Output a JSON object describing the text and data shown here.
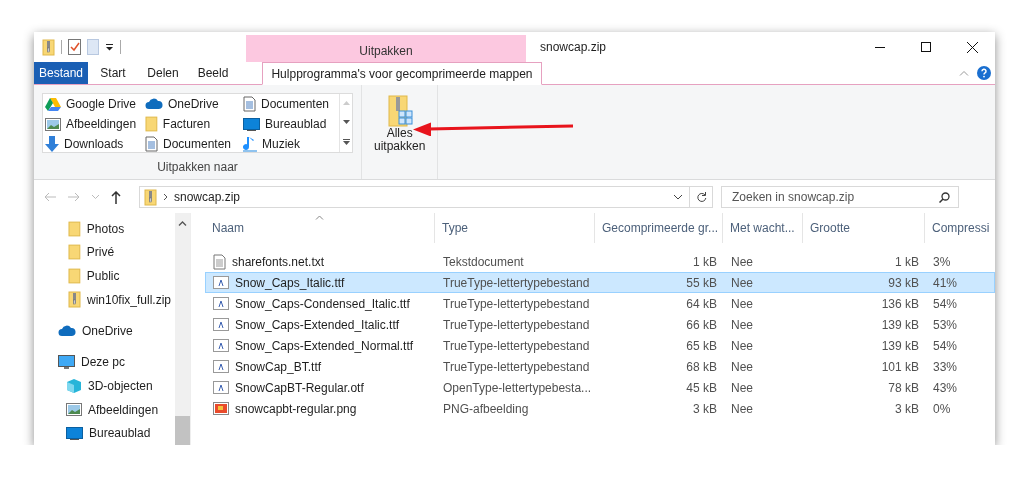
{
  "window": {
    "title": "snowcap.zip"
  },
  "ribbon": {
    "context_header": "Uitpakken",
    "tabs": [
      {
        "label": "Bestand",
        "kind": "file",
        "selected": false
      },
      {
        "label": "Start",
        "kind": "plain",
        "selected": false
      },
      {
        "label": "Delen",
        "kind": "plain",
        "selected": false
      },
      {
        "label": "Beeld",
        "kind": "plain",
        "selected": false
      },
      {
        "label": "Hulpprogramma's voor gecomprimeerde mappen",
        "kind": "context",
        "selected": true
      }
    ],
    "destinations": [
      {
        "label": "Google Drive",
        "kind": "gdrive"
      },
      {
        "label": "OneDrive",
        "kind": "cloud"
      },
      {
        "label": "Documenten",
        "kind": "doc"
      },
      {
        "label": "Afbeeldingen",
        "kind": "pictures"
      },
      {
        "label": "Facturen",
        "kind": "folder"
      },
      {
        "label": "Bureaublad",
        "kind": "desktop"
      },
      {
        "label": "Downloads",
        "kind": "download"
      },
      {
        "label": "Documenten",
        "kind": "doc"
      },
      {
        "label": "Muziek",
        "kind": "music"
      }
    ],
    "group_label": "Uitpakken naar",
    "extract_button": "Alles\nuitpakken"
  },
  "address": {
    "path": "snowcap.zip",
    "search_placeholder": "Zoeken in snowcap.zip"
  },
  "sidebar": {
    "items": [
      {
        "label": "Photos",
        "kind": "folder"
      },
      {
        "label": "Privé",
        "kind": "folder"
      },
      {
        "label": "Public",
        "kind": "folder"
      },
      {
        "label": "win10fix_full.zip",
        "kind": "zip"
      },
      {
        "label": "OneDrive",
        "kind": "cloud"
      },
      {
        "label": "Deze pc",
        "kind": "pc",
        "children": [
          {
            "label": "3D-objecten",
            "kind": "cube"
          },
          {
            "label": "Afbeeldingen",
            "kind": "pictures"
          },
          {
            "label": "Bureaublad",
            "kind": "desktop"
          }
        ]
      }
    ]
  },
  "table": {
    "columns": [
      "Naam",
      "Type",
      "Gecomprimeerde gr...",
      "Met wacht...",
      "Grootte",
      "Compressi"
    ],
    "rows": [
      {
        "kind": "txt",
        "selected": false,
        "cells": [
          "sharefonts.net.txt",
          "Tekstdocument",
          "1 kB",
          "Nee",
          "1 kB",
          "3%"
        ]
      },
      {
        "kind": "font",
        "selected": true,
        "cells": [
          "Snow_Caps_Italic.ttf",
          "TrueType-lettertypebestand",
          "55 kB",
          "Nee",
          "93 kB",
          "41%"
        ]
      },
      {
        "kind": "font",
        "selected": false,
        "cells": [
          "Snow_Caps-Condensed_Italic.ttf",
          "TrueType-lettertypebestand",
          "64 kB",
          "Nee",
          "136 kB",
          "54%"
        ]
      },
      {
        "kind": "font",
        "selected": false,
        "cells": [
          "Snow_Caps-Extended_Italic.ttf",
          "TrueType-lettertypebestand",
          "66 kB",
          "Nee",
          "139 kB",
          "53%"
        ]
      },
      {
        "kind": "font",
        "selected": false,
        "cells": [
          "Snow_Caps-Extended_Normal.ttf",
          "TrueType-lettertypebestand",
          "65 kB",
          "Nee",
          "139 kB",
          "54%"
        ]
      },
      {
        "kind": "font",
        "selected": false,
        "cells": [
          "SnowCap_BT.ttf",
          "TrueType-lettertypebestand",
          "68 kB",
          "Nee",
          "101 kB",
          "33%"
        ]
      },
      {
        "kind": "font",
        "selected": false,
        "cells": [
          "SnowCapBT-Regular.otf",
          "OpenType-lettertypebesta...",
          "45 kB",
          "Nee",
          "78 kB",
          "43%"
        ]
      },
      {
        "kind": "png",
        "selected": false,
        "cells": [
          "snowcapbt-regular.png",
          "PNG-afbeelding",
          "3 kB",
          "Nee",
          "3 kB",
          "0%"
        ]
      }
    ]
  }
}
